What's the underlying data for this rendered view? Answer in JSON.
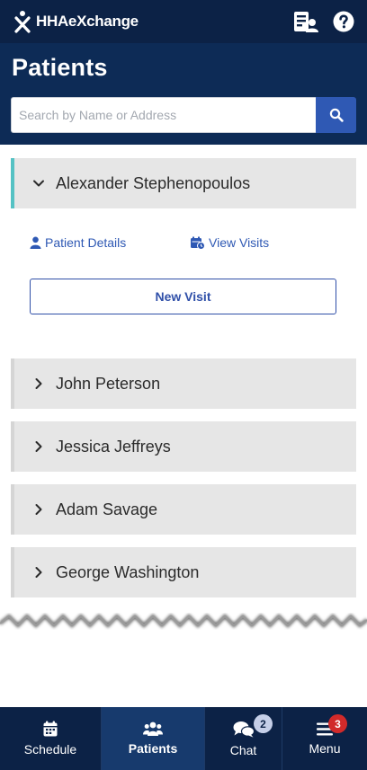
{
  "app": {
    "logo_text": "HHAeXchange"
  },
  "page": {
    "title": "Patients"
  },
  "search": {
    "placeholder": "Search by Name or Address"
  },
  "patients": [
    {
      "name": "Alexander Stephenopoulos",
      "expanded": true
    },
    {
      "name": "John Peterson",
      "expanded": false
    },
    {
      "name": "Jessica Jeffreys",
      "expanded": false
    },
    {
      "name": "Adam Savage",
      "expanded": false
    },
    {
      "name": "George Washington",
      "expanded": false
    }
  ],
  "details": {
    "patient_details_label": "Patient Details",
    "view_visits_label": "View Visits",
    "new_visit_label": "New Visit"
  },
  "nav": {
    "items": [
      {
        "label": "Schedule",
        "icon": "calendar-icon",
        "active": false
      },
      {
        "label": "Patients",
        "icon": "users-icon",
        "active": true
      },
      {
        "label": "Chat",
        "icon": "chat-icon",
        "active": false,
        "badge": "2"
      },
      {
        "label": "Menu",
        "icon": "hamburger-icon",
        "active": false,
        "badge": "3"
      }
    ]
  },
  "colors": {
    "header": "#0c2246",
    "title_bar": "#0d2b56",
    "accent": "#2f59b4",
    "expanded_marker": "#55c2c4",
    "badge_red": "#d12a2a"
  }
}
